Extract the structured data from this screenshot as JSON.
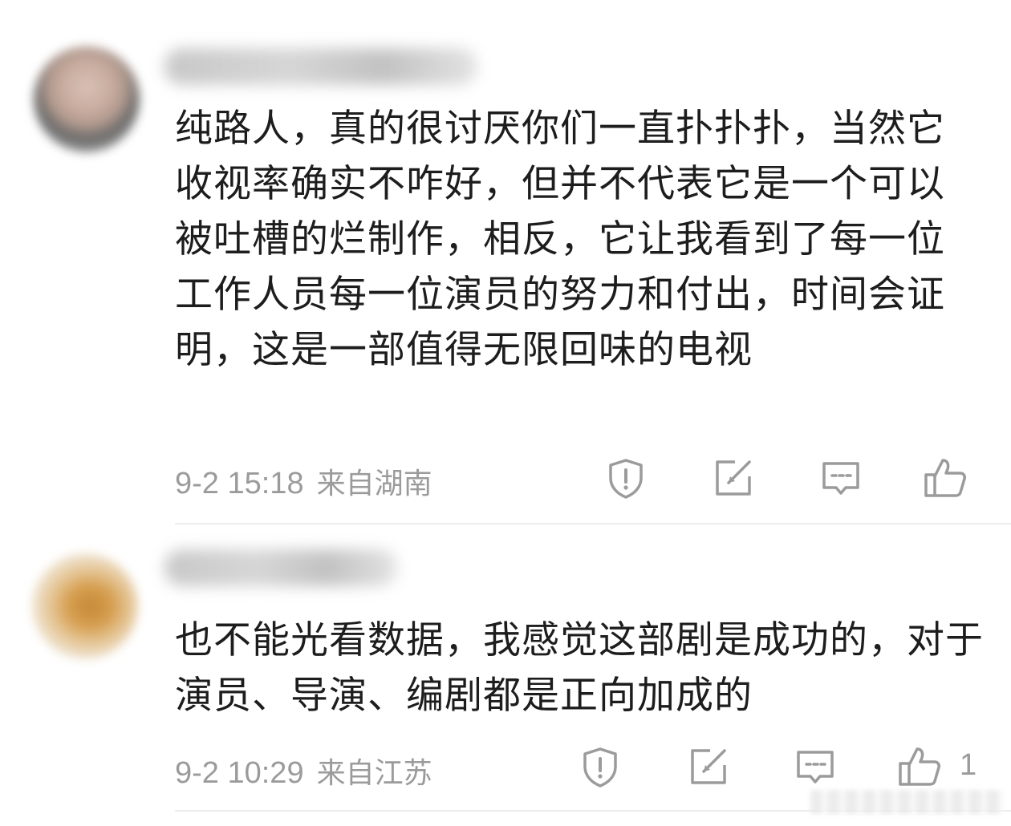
{
  "comments": [
    {
      "avatar_icon": "user-avatar",
      "content": "纯路人，真的很讨厌你们一直扑扑扑，当然它收视率确实不咋好，但并不代表它是一个可以被吐槽的烂制作，相反，它让我看到了每一位工作人员每一位演员的努力和付出，时间会证明，这是一部值得无限回味的电视",
      "time": "9-2 15:18",
      "location": "来自湖南",
      "likes": ""
    },
    {
      "avatar_icon": "user-avatar",
      "content": "也不能光看数据，我感觉这部剧是成功的，对于演员、导演、编剧都是正向加成的",
      "time": "9-2 10:29",
      "location": "来自江苏",
      "likes": "1"
    }
  ],
  "actions": {
    "report_icon": "report-icon",
    "repost_icon": "repost-icon",
    "reply_icon": "reply-icon",
    "like_icon": "like-icon"
  },
  "colors": {
    "text": "#1d1d1d",
    "meta": "#9b9b9b",
    "icon": "#9b9b9b",
    "divider": "#ececec"
  }
}
